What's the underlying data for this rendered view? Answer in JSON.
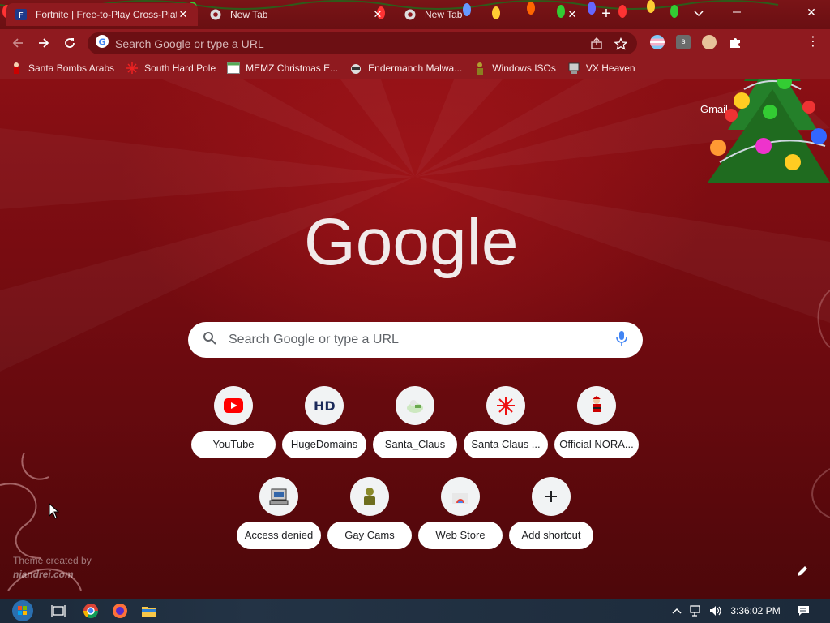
{
  "browser": {
    "tabs": [
      {
        "title": "Fortnite | Free-to-Play Cross-Platform",
        "active": true
      },
      {
        "title": "New Tab",
        "active": false
      },
      {
        "title": "New Tab",
        "active": false
      }
    ],
    "toolbar": {
      "omnibox_placeholder": "Search Google or type a URL"
    },
    "bookmarks": [
      {
        "label": "Santa Bombs Arabs",
        "icon": "santa-icon"
      },
      {
        "label": "South Hard Pole",
        "icon": "snowflake-icon"
      },
      {
        "label": "MEMZ Christmas E...",
        "icon": "window-icon"
      },
      {
        "label": "Endermanch Malwa...",
        "icon": "raccoon-icon"
      },
      {
        "label": "Windows ISOs",
        "icon": "figure-icon"
      },
      {
        "label": "VX Heaven",
        "icon": "computer-icon"
      }
    ]
  },
  "page": {
    "gmail_link": "Gmail",
    "logo_text": "Google",
    "search_placeholder": "Search Google or type a URL",
    "shortcuts_row1": [
      {
        "label": "YouTube",
        "icon": "youtube-icon"
      },
      {
        "label": "HugeDomains",
        "icon": "hd-icon"
      },
      {
        "label": "Santa_Claus",
        "icon": "santa-claus-icon"
      },
      {
        "label": "Santa Claus ...",
        "icon": "snowflake-icon"
      },
      {
        "label": "Official NORA...",
        "icon": "norad-santa-icon"
      }
    ],
    "shortcuts_row2": [
      {
        "label": "Access denied",
        "icon": "computer-icon"
      },
      {
        "label": "Gay Cams",
        "icon": "figure-icon"
      },
      {
        "label": "Web Store",
        "icon": "web-store-icon"
      },
      {
        "label": "Add shortcut",
        "icon": "plus-icon"
      }
    ],
    "theme_credit": "Theme created by",
    "theme_author": "niandrei.com"
  },
  "taskbar": {
    "clock": "3:36:02 PM"
  },
  "colors": {
    "toolbar": "#8f1a1f",
    "page_top": "#8a0f14",
    "page_bottom": "#4d070a",
    "logo": "#f1eaea"
  }
}
